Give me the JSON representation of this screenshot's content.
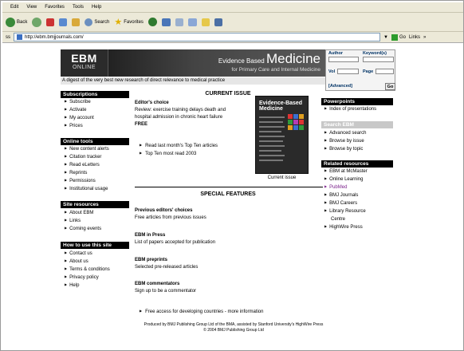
{
  "browser": {
    "menu": [
      "Edit",
      "View",
      "Favorites",
      "Tools",
      "Help"
    ],
    "toolbar": {
      "back_label": "Back",
      "search_label": "Search",
      "favorites_label": "Favorites"
    },
    "address": {
      "label": "ss",
      "url": "http://ebm.bmjjournals.com/",
      "go_label": "Go",
      "links_label": "Links"
    }
  },
  "banner": {
    "logo_line1": "EBM",
    "logo_line2": "ONLINE",
    "title_small": "Evidence Based ",
    "title_big": "Medicine",
    "subtitle": "for Primary Care and Internal Medicine",
    "tagline": "A digest of the very best new research of direct relevance to medical practice"
  },
  "search": {
    "author_label": "Author",
    "keyword_label": "Keyword(s)",
    "vol_label": "Vol",
    "page_label": "Page",
    "advanced_label": "[Advanced]",
    "go_label": "Go"
  },
  "left": {
    "subscriptions": {
      "title": "Subscriptions",
      "items": [
        "Subscribe",
        "Activate",
        "My account",
        "Prices"
      ]
    },
    "online_tools": {
      "title": "Online tools",
      "items": [
        "New content alerts",
        "Citation tracker",
        "Read eLetters",
        "Reprints",
        "Permissions",
        "Institutional usage"
      ]
    },
    "site_resources": {
      "title": "Site resources",
      "items": [
        "About EBM",
        "Links",
        "Coming events"
      ]
    },
    "how_to_use": {
      "title": "How to use this site",
      "items": [
        "Contact us",
        "About us",
        "Terms & conditions",
        "Privacy policy",
        "Help"
      ]
    }
  },
  "center": {
    "current_issue_heading": "CURRENT ISSUE",
    "editors_choice_title": "Editor's choice",
    "editors_choice_line1": "Review: exercise training delays death and",
    "editors_choice_line2": "hospital admission in chronic heart failure",
    "free_label": "FREE",
    "top_ten_last_month": "Read last month's Top Ten articles",
    "top_ten_2003": "Top Ten most read 2003",
    "cover_title_line1": "Evidence-Based",
    "cover_title_line2": "Medicine",
    "cover_caption": "Current issue",
    "special_features_heading": "SPECIAL FEATURES",
    "features": [
      {
        "title": "Previous editors' choices",
        "desc": "Free articles from previous issues"
      },
      {
        "title": "EBM in Press",
        "desc": "List of papers accepted for publication"
      },
      {
        "title": "EBM preprints",
        "desc": "Selected pre-released articles"
      },
      {
        "title": "EBM commentators",
        "desc": "Sign up to be a commentator"
      }
    ],
    "developing_countries": "Free access for developing countries - more information"
  },
  "right": {
    "powerpoints": {
      "title": "Powerpoints",
      "items": [
        "Index of presentations"
      ]
    },
    "search_ebm": {
      "title": "Search EBM",
      "items": [
        "Advanced search",
        "Browse by issue",
        "Browse by topic"
      ]
    },
    "related_resources": {
      "title": "Related resources",
      "items": [
        "EBM at McMaster",
        "Online Learning",
        "PubMed",
        "BMJ Journals",
        "BMJ Careers",
        "Library Resource",
        "Centre",
        "HighWire Press"
      ]
    }
  },
  "footer": {
    "line1": "Produced by BMJ Publishing Group Ltd of the BMA, assisted by Stanford University's HighWire Press",
    "line2": "© 2004 BMJ Publishing Group Ltd"
  },
  "colors": {
    "chrome": "#ece9d8",
    "box_header": "#000000",
    "search_header": "#c8c8c8",
    "pubmed_link": "#7a1f8a"
  }
}
